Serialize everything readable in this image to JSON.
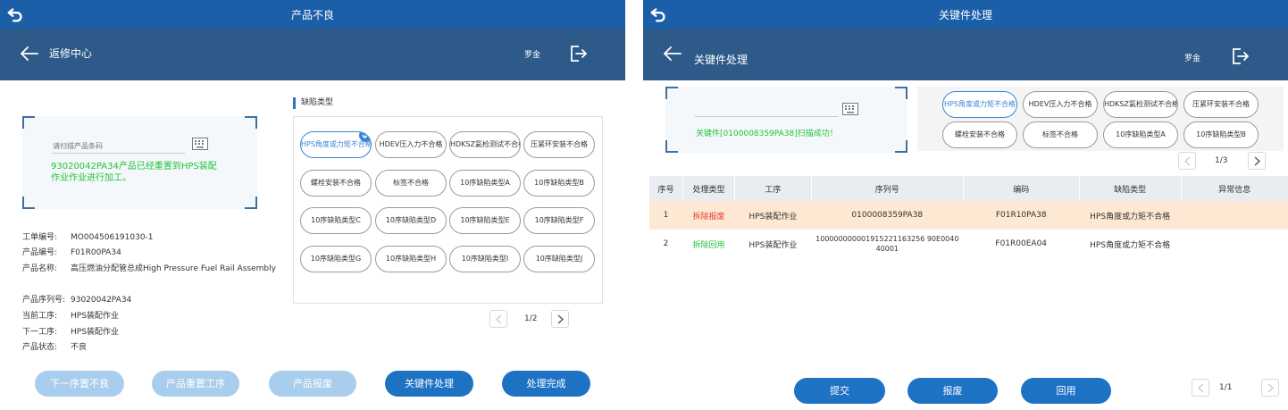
{
  "left": {
    "topbar_title": "产品不良",
    "header_title": "返修中心",
    "user": "罗金",
    "scan": {
      "placeholder": "请扫描产品条码",
      "message": "93020042PA34产品已经重置到HPS装配作业作业进行加工。"
    },
    "info": [
      {
        "key": "工单编号:",
        "value": "MO004506191030-1"
      },
      {
        "key": "产品编号:",
        "value": "F01R00PA34"
      },
      {
        "key": "产品名称:",
        "value": "高压燃油分配管总成High Pressure Fuel Rail  Assembly"
      },
      {
        "key": "产品序列号:",
        "value": "93020042PA34"
      },
      {
        "key": "当前工序:",
        "value": "HPS装配作业"
      },
      {
        "key": "下一工序:",
        "value": "HPS装配作业"
      },
      {
        "key": "产品状态:",
        "value": "不良"
      }
    ],
    "defect_title": "缺陷类型",
    "defects": [
      "HPS角度或力矩不合格",
      "HDEV压入力不合格",
      "HDKSZ氦检测试不合格",
      "压紧环安装不合格",
      "螺栓安装不合格",
      "标签不合格",
      "10序缺陷类型A",
      "10序缺陷类型B",
      "10序缺陷类型C",
      "10序缺陷类型D",
      "10序缺陷类型E",
      "10序缺陷类型F",
      "10序缺陷类型G",
      "10序缺陷类型H",
      "10序缺陷类型I",
      "10序缺陷类型J"
    ],
    "selected_defect": 0,
    "pager": "1/2",
    "buttons": [
      "下一序置不良",
      "产品重置工序",
      "产品报废",
      "关键件处理",
      "处理完成"
    ]
  },
  "right": {
    "topbar_title": "关键件处理",
    "header_title": "关键件处理",
    "user": "罗金",
    "scan": {
      "placeholder": "",
      "message": "关键件[0100008359PA38]扫描成功！"
    },
    "defects": [
      "HPS角度或力矩不合格",
      "HDEV压入力不合格",
      "HDKSZ氦检测试不合格",
      "压紧环安装不合格",
      "螺栓安装不合格",
      "标签不合格",
      "10序缺陷类型A",
      "10序缺陷类型B"
    ],
    "selected_defect": 0,
    "pager_top": "1/3",
    "table": {
      "headers": [
        "序号",
        "处理类型",
        "工序",
        "序列号",
        "编码",
        "缺陷类型",
        "异常信息"
      ],
      "rows": [
        {
          "no": "1",
          "type": "拆除报废",
          "process": "HPS装配作业",
          "serial": "0100008359PA38",
          "code": "F01R10PA38",
          "defect": "HPS角度或力矩不合格",
          "error": ""
        },
        {
          "no": "2",
          "type": "拆除回用",
          "process": "HPS装配作业",
          "serial": "100000000001915221163256 90E004040001",
          "code": "F01R00EA04",
          "defect": "HPS角度或力矩不合格",
          "error": ""
        }
      ]
    },
    "buttons": [
      "提交",
      "报废",
      "回用"
    ],
    "pager_bottom": "1/1"
  },
  "colors": {
    "topbar": "#1a5fa8",
    "header": "#2e5a8a",
    "primary": "#1e72c4",
    "disabled": "#a9cdec",
    "success": "#22c23a",
    "danger": "#e43c2f",
    "highlight_row": "#fde9d3"
  }
}
